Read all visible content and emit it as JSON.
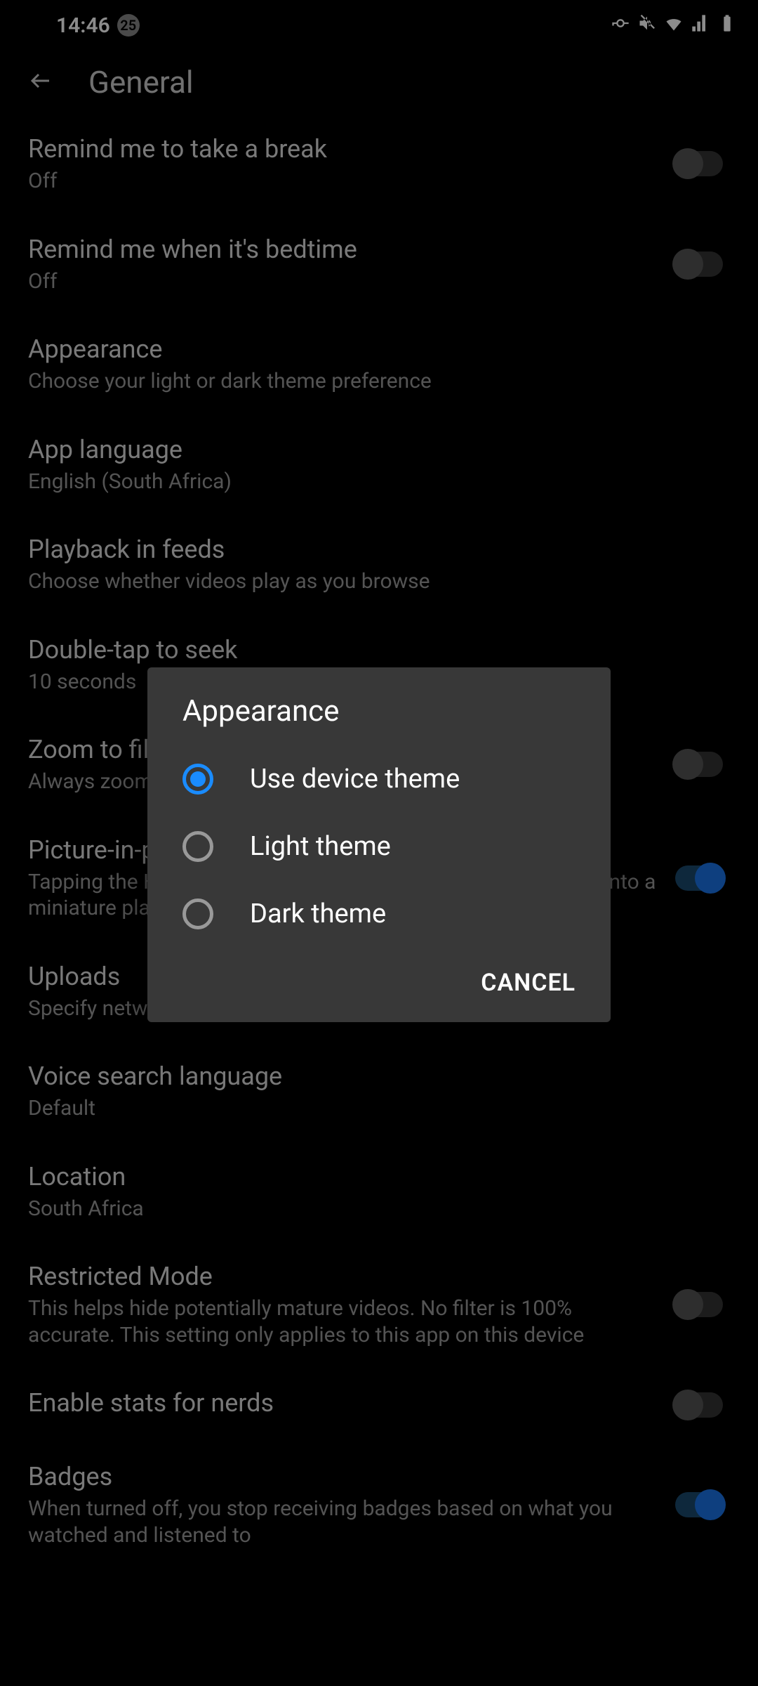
{
  "status": {
    "time": "14:46",
    "badge_count": "25"
  },
  "header": {
    "title": "General"
  },
  "settings": [
    {
      "title": "Remind me to take a break",
      "sub": "Off",
      "toggle": "off"
    },
    {
      "title": "Remind me when it's bedtime",
      "sub": "Off",
      "toggle": "off"
    },
    {
      "title": "Appearance",
      "sub": "Choose your light or dark theme preference",
      "toggle": null
    },
    {
      "title": "App language",
      "sub": "English (South Africa)",
      "toggle": null
    },
    {
      "title": "Playback in feeds",
      "sub": "Choose whether videos play as you browse",
      "toggle": null
    },
    {
      "title": "Double-tap to seek",
      "sub": "10 seconds",
      "toggle": null
    },
    {
      "title": "Zoom to fill screen",
      "sub": "Always zoom so that videos fill the screen in full screen",
      "toggle": "off"
    },
    {
      "title": "Picture-in-picture",
      "sub": "Tapping the Home button while watching a video will shrink it into a miniature player",
      "toggle": "on"
    },
    {
      "title": "Uploads",
      "sub": "Specify network preferences for uploads",
      "toggle": null
    },
    {
      "title": "Voice search language",
      "sub": "Default",
      "toggle": null
    },
    {
      "title": "Location",
      "sub": "South Africa",
      "toggle": null
    },
    {
      "title": "Restricted Mode",
      "sub": "This helps hide potentially mature videos. No filter is 100% accurate. This setting only applies to this app on this device",
      "toggle": "off"
    },
    {
      "title": "Enable stats for nerds",
      "sub": "",
      "toggle": "off"
    },
    {
      "title": "Badges",
      "sub": "When turned off, you stop receiving badges based on what you watched and listened to",
      "toggle": "on"
    }
  ],
  "dialog": {
    "title": "Appearance",
    "options": [
      {
        "label": "Use device theme",
        "selected": true
      },
      {
        "label": "Light theme",
        "selected": false
      },
      {
        "label": "Dark theme",
        "selected": false
      }
    ],
    "cancel": "CANCEL"
  }
}
